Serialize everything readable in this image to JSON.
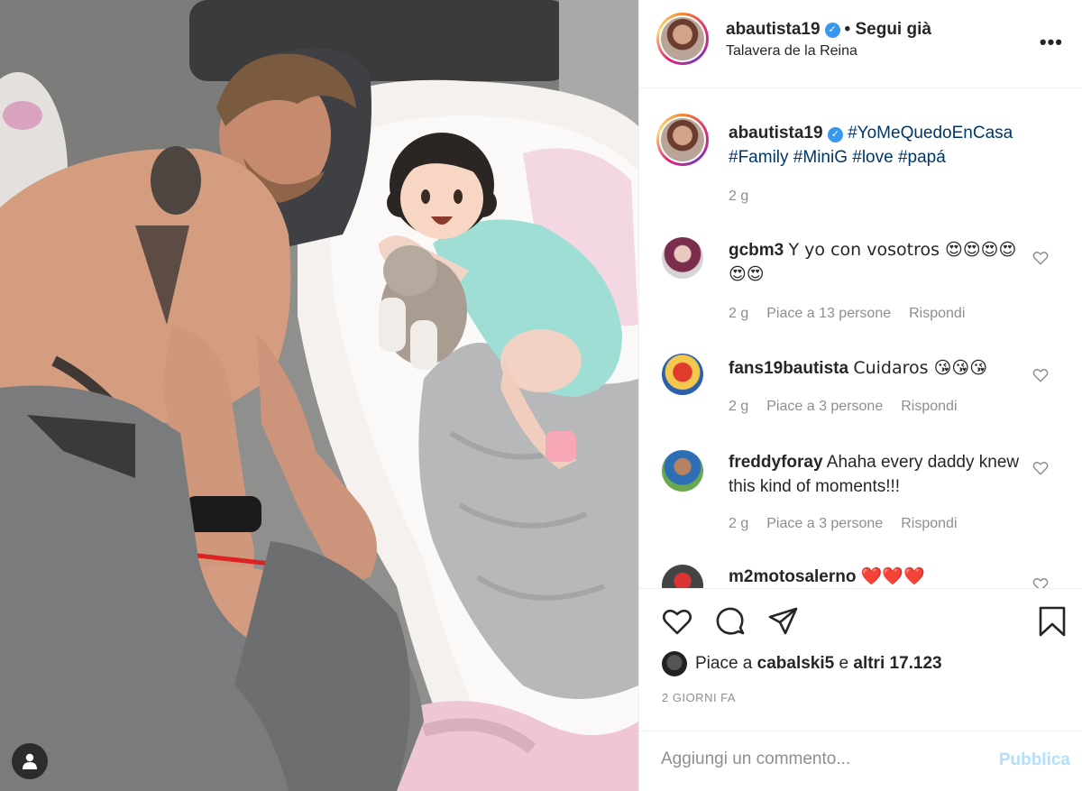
{
  "post": {
    "username": "abautista19",
    "follow_state": "• Segui già",
    "location": "Talavera de la Reina",
    "more_label": "•••"
  },
  "caption": {
    "username": "abautista19",
    "hashtags": [
      "#YoMeQuedoEnCasa",
      "#Family",
      "#MiniG",
      "#love",
      "#papá"
    ],
    "time": "2 g"
  },
  "comments": [
    {
      "username": "gcbm3",
      "text": "Y yo con vosotros 😍😍😍😍😍😍",
      "time": "2 g",
      "likes": "Piace a 13 persone",
      "reply": "Rispondi"
    },
    {
      "username": "fans19bautista",
      "text": "Cuidaros 😘😘😘",
      "time": "2 g",
      "likes": "Piace a 3 persone",
      "reply": "Rispondi"
    },
    {
      "username": "freddyforay",
      "text": "Ahaha every daddy knew this kind of moments!!!",
      "time": "2 g",
      "likes": "Piace a 3 persone",
      "reply": "Rispondi"
    },
    {
      "username": "m2motosalerno",
      "text": "❤️❤️❤️",
      "time": "",
      "likes": "",
      "reply": ""
    }
  ],
  "likes": {
    "prefix": "Piace a",
    "first_user": "cabalski5",
    "conjunction": "e",
    "others": "altri 17.123"
  },
  "date": "2 GIORNI FA",
  "comment_box": {
    "placeholder": "Aggiungi un commento...",
    "publish_label": "Pubblica"
  },
  "icons": {
    "like": "heart-icon",
    "comment": "comment-icon",
    "share": "share-icon",
    "save": "bookmark-icon",
    "tag_users": "user-icon",
    "verified": "verified-badge-icon"
  },
  "colors": {
    "text": "#262626",
    "muted": "#8e8e8e",
    "hashtag": "#00376b",
    "verified": "#3897f0",
    "publish_disabled": "#b2dffc",
    "comment_heart": "#e8271b"
  }
}
